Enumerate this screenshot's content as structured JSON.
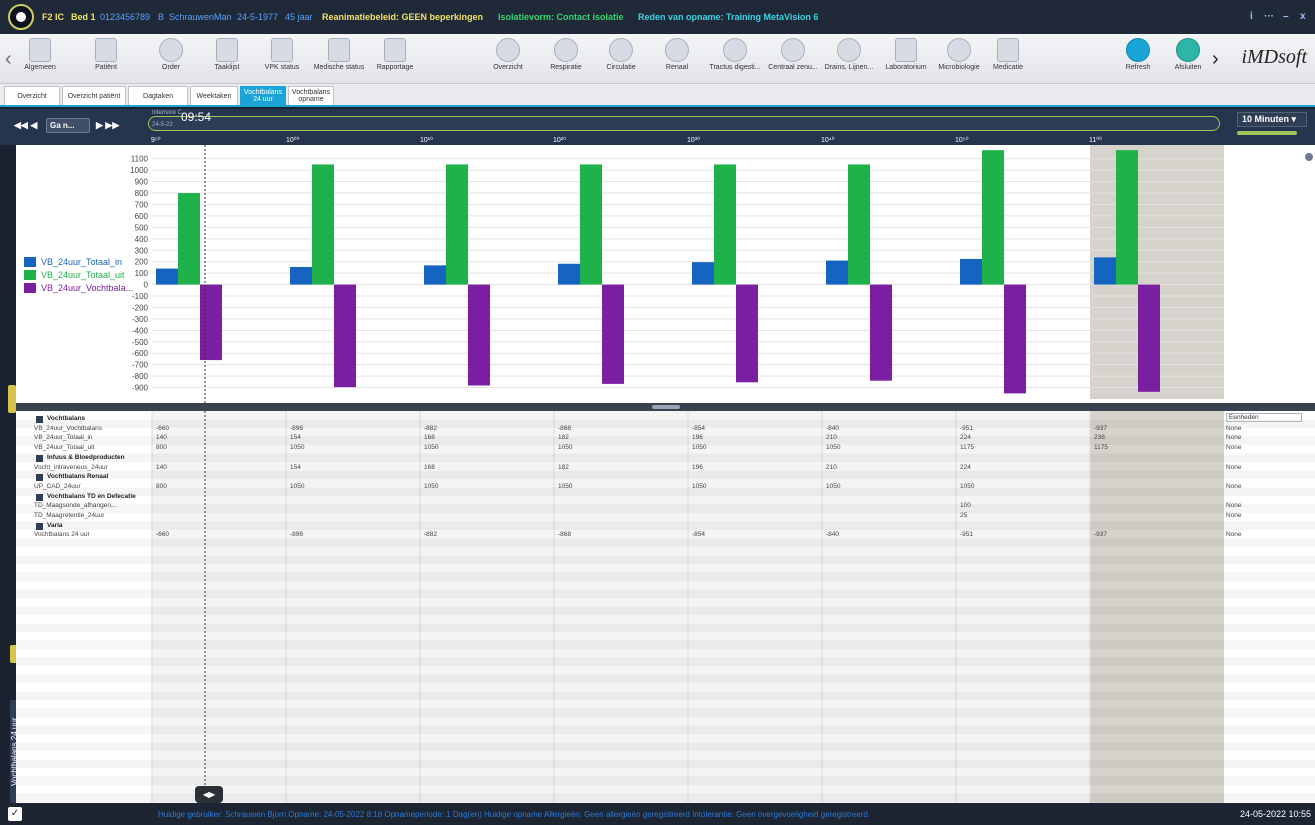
{
  "titlebar": {
    "unit": "F2 IC",
    "bed": "Bed 1",
    "patient_id": "0123456789",
    "initial": "B",
    "name": "Schrauwen",
    "sex": "Man",
    "dob": "24-5-1977",
    "age": "45 jaar",
    "reanimation": "Reanimatiebeleid: GEEN beperkingen",
    "isolation": "Isolatievorm: Contact isolatie",
    "reason": "Reden van opname: Training MetaVision 6",
    "controls": [
      "i",
      "···",
      "–",
      "x"
    ]
  },
  "toolbar": {
    "items": [
      {
        "label": "Algemeen"
      },
      {
        "label": "Patiënt"
      },
      {
        "label": "Order"
      },
      {
        "label": "Taaklijst"
      },
      {
        "label": "VPK status"
      },
      {
        "label": "Medische status"
      },
      {
        "label": "Rapportage"
      },
      {
        "label": "Overzicht"
      },
      {
        "label": "Respiratie"
      },
      {
        "label": "Circulatie"
      },
      {
        "label": "Renaal"
      },
      {
        "label": "Tractus digesti..."
      },
      {
        "label": "Centraal zenu..."
      },
      {
        "label": "Drains, Lijnen..."
      },
      {
        "label": "Laboratorium"
      },
      {
        "label": "Microbiologie"
      },
      {
        "label": "Medicatie"
      },
      {
        "label": "Refresh"
      },
      {
        "label": "Afsluiten"
      }
    ],
    "brand": "iMDsoft"
  },
  "tabs": [
    {
      "label": "Overzicht"
    },
    {
      "label": "Overzicht patiënt"
    },
    {
      "label": "Dagtaken"
    },
    {
      "label": "Weektaken"
    },
    {
      "label": "Vochtbalans 24 uur",
      "active": true
    },
    {
      "label": "Vochtbalans opname"
    }
  ],
  "timeline": {
    "goto": "Ga n...",
    "context": "Intensive C",
    "time": "09:54",
    "date": "24-5-22",
    "ticks": [
      "9⁵⁰",
      "10⁰⁰",
      "10¹⁰",
      "10²⁰",
      "10³⁰",
      "10⁴⁰",
      "10⁵⁰",
      "11⁰⁰"
    ],
    "zoom": "10 Minuten"
  },
  "colors": {
    "in": "#1565c0",
    "uit": "#1fb24a",
    "balans": "#7b1fa2"
  },
  "chart_data": {
    "type": "bar",
    "categories": [
      "1",
      "2",
      "3",
      "4",
      "5",
      "6",
      "7",
      "8"
    ],
    "series": [
      {
        "name": "VB_24uur_Totaal_in",
        "values": [
          140,
          154,
          168,
          182,
          196,
          210,
          224,
          238
        ]
      },
      {
        "name": "VB_24uur_Totaal_uit",
        "values": [
          800,
          1050,
          1050,
          1050,
          1050,
          1050,
          1175,
          1175
        ]
      },
      {
        "name": "VB_24uur_Vochtbala...",
        "values": [
          -660,
          -896,
          -882,
          -868,
          -854,
          -840,
          -951,
          -937
        ]
      }
    ],
    "ylim": [
      -1000,
      1150
    ],
    "yticks": [
      1100,
      1000,
      900,
      800,
      700,
      600,
      500,
      400,
      300,
      200,
      100,
      0,
      -100,
      -200,
      -300,
      -400,
      -500,
      -600,
      -700,
      -800,
      -900
    ],
    "grid": true,
    "legend": "left"
  },
  "grid": {
    "units_header": "Eenheden",
    "rows": [
      {
        "type": "group",
        "label": "Vochtbalans",
        "values": [],
        "unit": ""
      },
      {
        "type": "row",
        "label": "VB_24uur_Vochtbalans",
        "values": [
          "-660",
          "-896",
          "-882",
          "-868",
          "-854",
          "-840",
          "-951",
          "-937"
        ],
        "unit": "None"
      },
      {
        "type": "row",
        "label": "VB_24uur_Totaal_in",
        "values": [
          "140",
          "154",
          "168",
          "182",
          "196",
          "210",
          "224",
          "238"
        ],
        "unit": "None"
      },
      {
        "type": "row",
        "label": "VB_24uur_Totaal_uit",
        "values": [
          "800",
          "1050",
          "1050",
          "1050",
          "1050",
          "1050",
          "1175",
          "1175"
        ],
        "unit": "None"
      },
      {
        "type": "group",
        "label": "Infuus & Bloedproducten",
        "values": [],
        "unit": ""
      },
      {
        "type": "row",
        "label": "Vocht_intraveneus_24uur",
        "values": [
          "140",
          "154",
          "168",
          "182",
          "196",
          "210",
          "224",
          ""
        ],
        "unit": "None"
      },
      {
        "type": "group",
        "label": "Vochtbalans Renaal",
        "values": [],
        "unit": ""
      },
      {
        "type": "row",
        "label": "UP_CAD_24uur",
        "values": [
          "800",
          "1050",
          "1050",
          "1050",
          "1050",
          "1050",
          "1050",
          ""
        ],
        "unit": "None"
      },
      {
        "type": "group",
        "label": "Vochtbalans TD en Defecatie",
        "values": [],
        "unit": ""
      },
      {
        "type": "row",
        "label": "TD_Maagsonde_afhangen...",
        "values": [
          "",
          "",
          "",
          "",
          "",
          "",
          "100",
          ""
        ],
        "unit": "None"
      },
      {
        "type": "row",
        "label": "TD_Maagretentie_24uur",
        "values": [
          "",
          "",
          "",
          "",
          "",
          "",
          "25",
          ""
        ],
        "unit": "None"
      },
      {
        "type": "group",
        "label": "Varia",
        "values": [],
        "unit": ""
      },
      {
        "type": "row",
        "label": "Vochtbalans 24 uur",
        "values": [
          "-660",
          "-896",
          "-882",
          "-868",
          "-854",
          "-840",
          "-951",
          "-937"
        ],
        "unit": "None"
      }
    ]
  },
  "sidetab": "Vochtbalans 24 uur",
  "statusbar": {
    "text": "Huidige gebruiker: Schrauwen Bjorn   Opname: 24-05-2022 8:18   Opnameperiode: 1 Dag(en)   Huidige opname   Allergieën: Geen allergieën geregistreerd   Intolerantie: Geen overgevoeligheid geregistreerd",
    "datetime": "24-05-2022 10:55"
  }
}
